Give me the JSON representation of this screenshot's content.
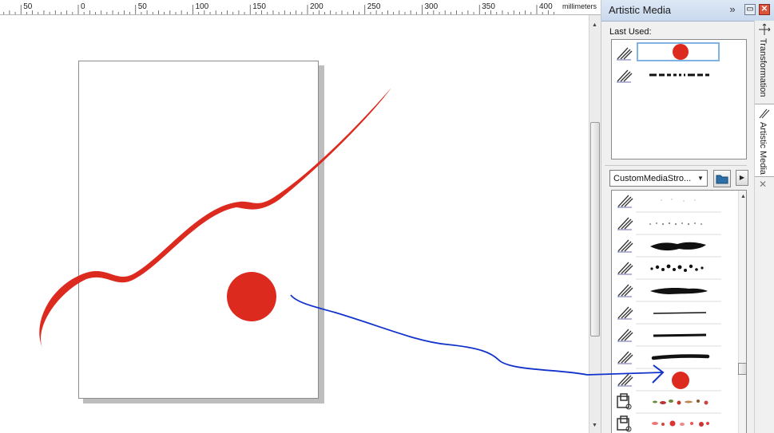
{
  "ruler": {
    "unit": "millimeters",
    "ticks": [
      {
        "label": "50"
      },
      {
        "label": "0"
      },
      {
        "label": "50"
      },
      {
        "label": "100"
      },
      {
        "label": "150"
      },
      {
        "label": "200"
      },
      {
        "label": "250"
      },
      {
        "label": "300"
      },
      {
        "label": "350"
      },
      {
        "label": "400"
      }
    ]
  },
  "docker": {
    "title": "Artistic Media",
    "last_used_label": "Last Used:",
    "last_used": [
      {
        "brush_icon": "brush-icon",
        "preview": "red-circle-stroke"
      },
      {
        "brush_icon": "brush-icon",
        "preview": "dashed-stroke"
      }
    ],
    "category": {
      "value": "CustomMediaStro..."
    },
    "strokes": [
      {
        "icon": "brush-icon",
        "preview": "faint-speckle"
      },
      {
        "icon": "brush-icon",
        "preview": "spray-dots"
      },
      {
        "icon": "brush-icon",
        "preview": "splatter"
      },
      {
        "icon": "brush-icon",
        "preview": "bubbles"
      },
      {
        "icon": "brush-icon",
        "preview": "rough-blob"
      },
      {
        "icon": "brush-icon",
        "preview": "thin-line"
      },
      {
        "icon": "brush-icon",
        "preview": "medium-line"
      },
      {
        "icon": "brush-icon",
        "preview": "rough-line"
      },
      {
        "icon": "brush-icon",
        "preview": "red-circle"
      },
      {
        "icon": "sprayer-icon",
        "preview": "object-spray-1"
      },
      {
        "icon": "sprayer-icon",
        "preview": "object-spray-2"
      }
    ]
  },
  "tabs": [
    {
      "label": "Transformation",
      "icon": "transformation-icon"
    },
    {
      "label": "Artistic Media",
      "icon": "artistic-media-icon"
    }
  ],
  "colors": {
    "stroke_red": "#dd2a1f",
    "annotation_blue": "#1133cc",
    "accent": "#7fb2e5"
  }
}
